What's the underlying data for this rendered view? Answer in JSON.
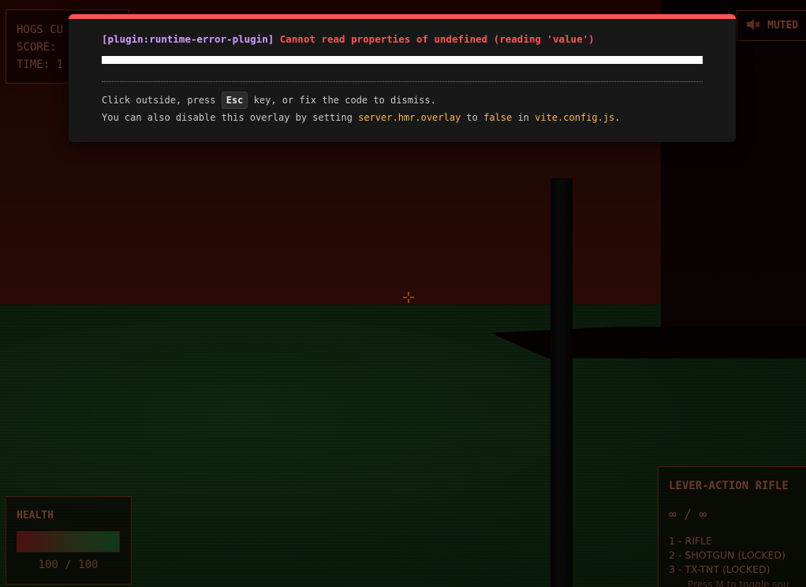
{
  "hud": {
    "stats": {
      "hogs_label": "HOGS CU",
      "score_label": "SCORE:",
      "time_label": "TIME: 1"
    },
    "audio": {
      "icon": "muted-speaker-icon",
      "label": "MUTED"
    },
    "health": {
      "title": "HEALTH",
      "value_text": "100 / 100",
      "level_percent": 100
    },
    "weapon": {
      "title": "LEVER-ACTION RIFLE",
      "ammo": "∞ / ∞",
      "slots": [
        "1 - RIFLE",
        "2 - SHOTGUN (LOCKED)",
        "3 - TX-TNT (LOCKED)"
      ],
      "hint": "Press M to toggle sou"
    }
  },
  "error_overlay": {
    "plugin_tag": "[plugin:runtime-error-plugin]",
    "message": "Cannot read properties of undefined (reading 'value')",
    "tip_line1_prefix": "Click outside, press",
    "tip_key": "Esc",
    "tip_line1_suffix": "key, or fix the code to dismiss.",
    "tip_line2_prefix": "You can also disable this overlay by setting",
    "tip_setting": "server.hmr.overlay",
    "tip_to": "to",
    "tip_value": "false",
    "tip_in": "in",
    "tip_file": "vite.config.js",
    "tip_end": "."
  },
  "colors": {
    "overlay_accent": "#ff5555",
    "plugin_color": "#cfa0ff",
    "code_color": "#f6b84b",
    "hud_border": "#4a1c0f"
  }
}
